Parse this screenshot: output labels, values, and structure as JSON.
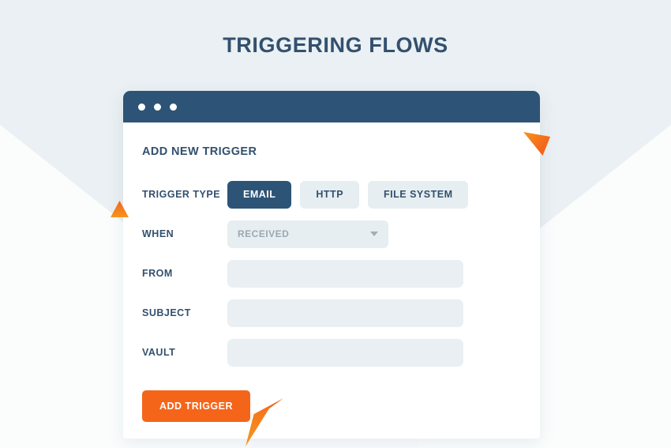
{
  "page": {
    "title": "TRIGGERING FLOWS",
    "background_color": "#eaf0f3",
    "accent_color": "#f4651a",
    "brand_color": "#2d5476"
  },
  "window": {
    "titlebar_color": "#2d5476",
    "dots": [
      "dot-1",
      "dot-2",
      "dot-3"
    ]
  },
  "form": {
    "heading": "ADD NEW TRIGGER",
    "trigger_type": {
      "label": "TRIGGER TYPE",
      "options": [
        {
          "label": "EMAIL",
          "selected": true
        },
        {
          "label": "HTTP",
          "selected": false
        },
        {
          "label": "FILE SYSTEM",
          "selected": false
        }
      ]
    },
    "when": {
      "label": "WHEN",
      "value": "RECEIVED",
      "caret_icon": "chevron-down-icon"
    },
    "fields": [
      {
        "label": "FROM",
        "value": "",
        "placeholder": ""
      },
      {
        "label": "SUBJECT",
        "value": "",
        "placeholder": ""
      },
      {
        "label": "VAULT",
        "value": "",
        "placeholder": ""
      }
    ],
    "submit": {
      "label": "ADD TRIGGER"
    }
  },
  "decorations": {
    "arrow_right": "orange-arrow-icon",
    "arrow_left": "orange-triangle-icon",
    "arrow_button": "orange-cursor-arrow-icon"
  }
}
